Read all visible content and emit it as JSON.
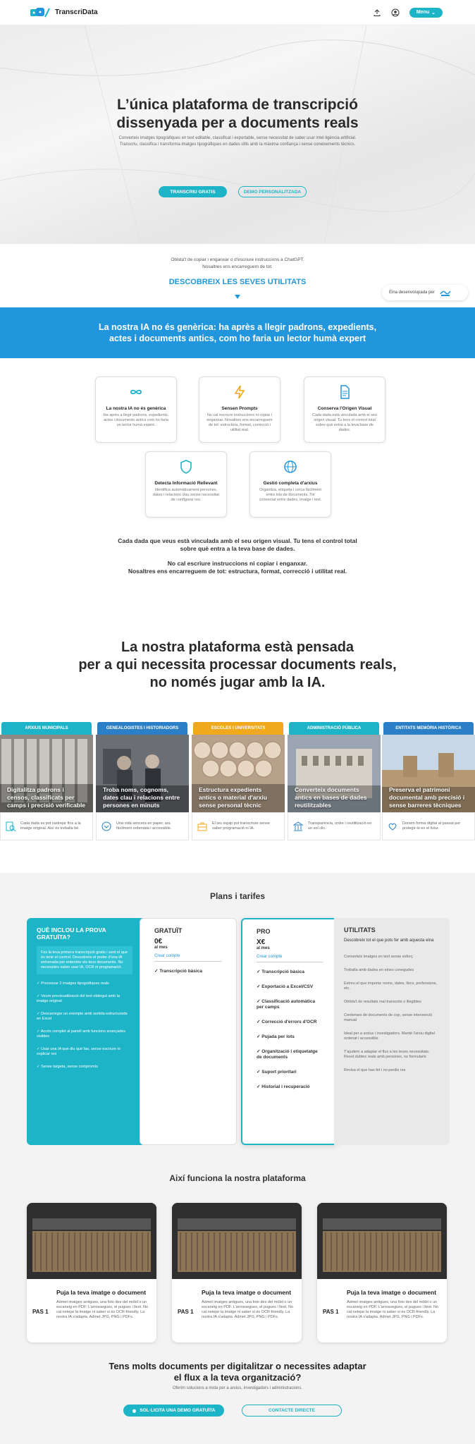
{
  "nav": {
    "brand": "TranscriData",
    "menu_label": "Menu"
  },
  "hero": {
    "title_line1": "L’única plataforma de transcripció",
    "title_line2": "dissenyada per a documents reals",
    "sub_line1": "Converteix imatges tipogràfiques en text editable, classificat i exportable, sense necessitat de saber usar intel·ligència artificial.",
    "sub_line2": "Transcriu, classifica i transforma imatges tipogràfiques en dades útils amb la màxima confiança i sense coneixements tècnics.",
    "btn_primary": "TRANSCRIU GRATIS",
    "btn_secondary": "DEMO PERSONALITZADA"
  },
  "intro": {
    "line1": "Oblida't de copiar i enganxar o d'escriure instruccions a ChatGPT.",
    "line2": "Nosaltres ens encarreguem de tot.",
    "discover": "DESCOBREIX LES SEVES UTILITATS",
    "badge": "Eina desenvolupada per"
  },
  "band": {
    "text": "La nostra IA no és genèrica: ha après a llegir padrons, expedients, actes i documents antics, com ho faria un lector humà expert"
  },
  "features": [
    {
      "title": "La nostra IA no és genèrica",
      "desc": "Ha après a llegir padrons, expedients, actes i documents antics com ho faria un lector humà expert."
    },
    {
      "title": "Sensen Prompts",
      "desc": "No cal escriure instruccions ni copiar i enganxar. Nosaltres ens encarreguem de tot: estructura, format, correcció i utilitat real."
    },
    {
      "title": "Conserva l'Origen Visual",
      "desc": "Cada dada està vinculada amb el seu origen visual. Tu tens el control total sobre què entra a la teva base de dades."
    },
    {
      "title": "Detecta Informació Rellevant",
      "desc": "Identifica automàticament persones, dates i relacions clau sense necessitat de configurar res."
    },
    {
      "title": "Gestió completa d'arxius",
      "desc": "Organitza, etiqueta i cerca fàcilment entre lots de documents. Tot connectat entre dades, imatge i text."
    }
  ],
  "feature_note": {
    "line1": "Cada dada que veus està vinculada amb el seu origen visual. Tu tens el control total",
    "line2": "sobre què entra a la teva base de dades.",
    "line3": "No cal escriure instruccions ni copiar i enganxar.",
    "line4": "Nosaltres ens encarreguem de tot: estructura, format, correcció i utilitat real."
  },
  "platform": {
    "line1": "La nostra plataforma està pensada",
    "line2": "per a qui necessita processar documents reals,",
    "line3": "no només jugar amb la IA."
  },
  "audiences": [
    {
      "tag": "ARXIUS MUNICIPALS",
      "caption": "Digitalitza padrons i censos, classificats per camps i precisió verificable",
      "foot": "Cada dada es pot rastrejar fins a la imatge original. Així és treballa bé.",
      "color": "#1eb4c8"
    },
    {
      "tag": "GENEALOGISTES I HISTORIADORS",
      "caption": "Troba noms, cognoms, dates clau i relacions entre persones en minuts",
      "foot": "Una vida sencera en paper, ara fàcilment ordenada i accessible.",
      "color": "#2a7fc6"
    },
    {
      "tag": "ESCOLES I UNIVERSITATS",
      "caption": "Estructura expedients antics o material d'arxiu sense personal tècnic",
      "foot": "El teu equip pot transcriure sense saber programació ni IA.",
      "color": "#f0a81c"
    },
    {
      "tag": "ADMINISTRACIÓ PÚBLICA",
      "caption": "Converteix documents antics en bases de dades reutilitzables",
      "foot": "Transparència, ordre i reutilització en un sol clic.",
      "color": "#1eb4c8"
    },
    {
      "tag": "ENTITATS MEMÒRIA HISTÒRICA",
      "caption": "Preserva el patrimoni documental amb precisió i sense barreres tècniques",
      "foot": "Donem forma digital al passat per protegir-lo en el futur.",
      "color": "#2a7fc6"
    }
  ],
  "pricing": {
    "title": "Plans i tarifes",
    "trial": {
      "title": "QUÈ INCLOU LA PROVA GRATUÏTA?",
      "box": "Fes la teva primera transcripció gratis i sent el que és tenir el control. Descobreix el poder d'una IA entrenada per entendre els teus documents. No necessites saber usar IA, OCR ni programació.",
      "items": [
        "✓ Processar 2 imatges tipogràfiques reals",
        "✓ Veure previsualització del text obtingut amb la imatge original",
        "✓ Descarregar un exemple amb sortida estructurada en Excel",
        "✓ Accés complet al panell amb funcions avançades visibles",
        "✓ Usar una IA que diu què fas, sense escriure ni explicar res",
        "✓ Sense targeta, sense compromís"
      ]
    },
    "free": {
      "name": "GRATUÏT",
      "price": "0€",
      "per": "al mes",
      "link": "Crear compte",
      "items": [
        "✓ Transcripció bàsica"
      ]
    },
    "pro": {
      "name": "PRO",
      "price": "X€",
      "per": "al mes",
      "link": "Crear compte",
      "items": [
        "✓ Transcripció bàsica",
        "✓ Exportació a Excel/CSV",
        "✓ Classificació automàtica per camps",
        "✓ Correcció d'errors d'OCR",
        "✓ Pujada per lots",
        "✓ Organització i etiquetatge de documents",
        "✓ Suport prioritari",
        "✓ Historial i recuperació"
      ]
    },
    "utilities": {
      "title": "UTILITATS",
      "sub": "Descobreix tot el que pots fer amb aquesta eina",
      "items": [
        "Converteix imatges en text sense esforç",
        "Treballa amb dades en eines conegudes",
        "Extreu el que importa: noms, dates, llocs, professions, etc.",
        "Oblida't de resultats mal transcrits o illegibles",
        "Centenars de documents de cop, sense intervenció manual",
        "Ideal per a arxius i investigadors. Manté l'arxiu digital ordenat i accessible",
        "T'ajudem a adaptar el flux a les teves necessitats. Resol dubtes reals amb persones, no formularis",
        "Revisa el que has fet i no perdis res"
      ]
    }
  },
  "how": {
    "title": "Així funciona la nostra plataforma",
    "steps": [
      {
        "pas": "PAS 1",
        "title": "Puja la teva imatge o document",
        "desc": "Admet imatges antigues, una foto des del mòbil o un escaneig en PDF. L'arrossegues, el pugues i llest. No cal netejar la imatge ni saber si és OCR-friendly. La nostra IA s'adapta. Admet JPG, PNG i PDFs."
      },
      {
        "pas": "PAS 1",
        "title": "Puja la teva imatge o document",
        "desc": "Admet imatges antigues, una foto des del mòbil o un escaneig en PDF. L'arrossegues, el pugues i llest. No cal netejar la imatge ni saber si és OCR-friendly. La nostra IA s'adapta. Admet JPG, PNG i PDFs."
      },
      {
        "pas": "PAS 1",
        "title": "Puja la teva imatge o document",
        "desc": "Admet imatges antigues, una foto des del mòbil o un escaneig en PDF. L'arrossegues, el pugues i llest. No cal netejar la imatge ni saber si és OCR-friendly. La nostra IA s'adapta. Admet JPG, PNG i PDFs."
      }
    ]
  },
  "cta": {
    "line1": "Tens molts documents per digitalitzar o necessites adaptar",
    "line2": "el flux a la teva organització?",
    "sub": "Oferim solucions a mida per a arxius, investigadors i administracions.",
    "btn_demo": "SOL·LICITA UNA DEMO GRATUÏTA",
    "btn_contact": "CONTACTE DIRECTE"
  },
  "colors": {
    "accent": "#1eb4c8",
    "blue": "#2296dc"
  }
}
